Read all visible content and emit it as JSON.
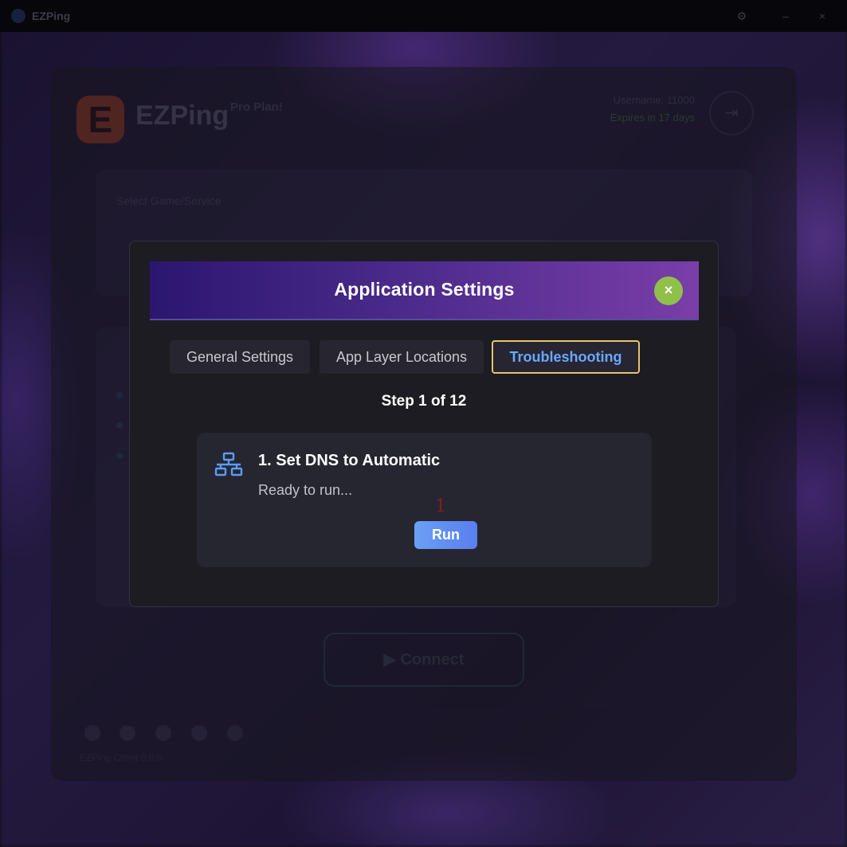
{
  "window": {
    "title": "EZPing",
    "controls": [
      "gear-icon",
      "minimize-icon",
      "close-icon"
    ]
  },
  "app": {
    "brand": "EZPing",
    "plan": "Pro Plan!",
    "username": "Username: 11000",
    "expires": "Expires in 17 days",
    "select_game_label": "Select Game/Service",
    "connect_label": "Connect",
    "version": "EZPing Client 0.0.0"
  },
  "modal": {
    "title": "Application Settings",
    "close_label": "×",
    "tabs": [
      {
        "label": "General Settings",
        "active": false
      },
      {
        "label": "App Layer Locations",
        "active": false
      },
      {
        "label": "Troubleshooting",
        "active": true
      }
    ],
    "step_label": "Step 1 of 12",
    "step": {
      "icon": "network-icon",
      "title": "1. Set DNS to Automatic",
      "status": "Ready to run...",
      "marker": "1",
      "run_label": "Run"
    }
  },
  "colors": {
    "header_gradient_start": "#2b1670",
    "header_gradient_end": "#7a3ea8",
    "close_button": "#8fc14a",
    "active_tab_text": "#6aa8ff",
    "active_tab_border": "#e4c56e",
    "run_button": "#6aa0f5",
    "icon_blue": "#5b9cf5"
  }
}
